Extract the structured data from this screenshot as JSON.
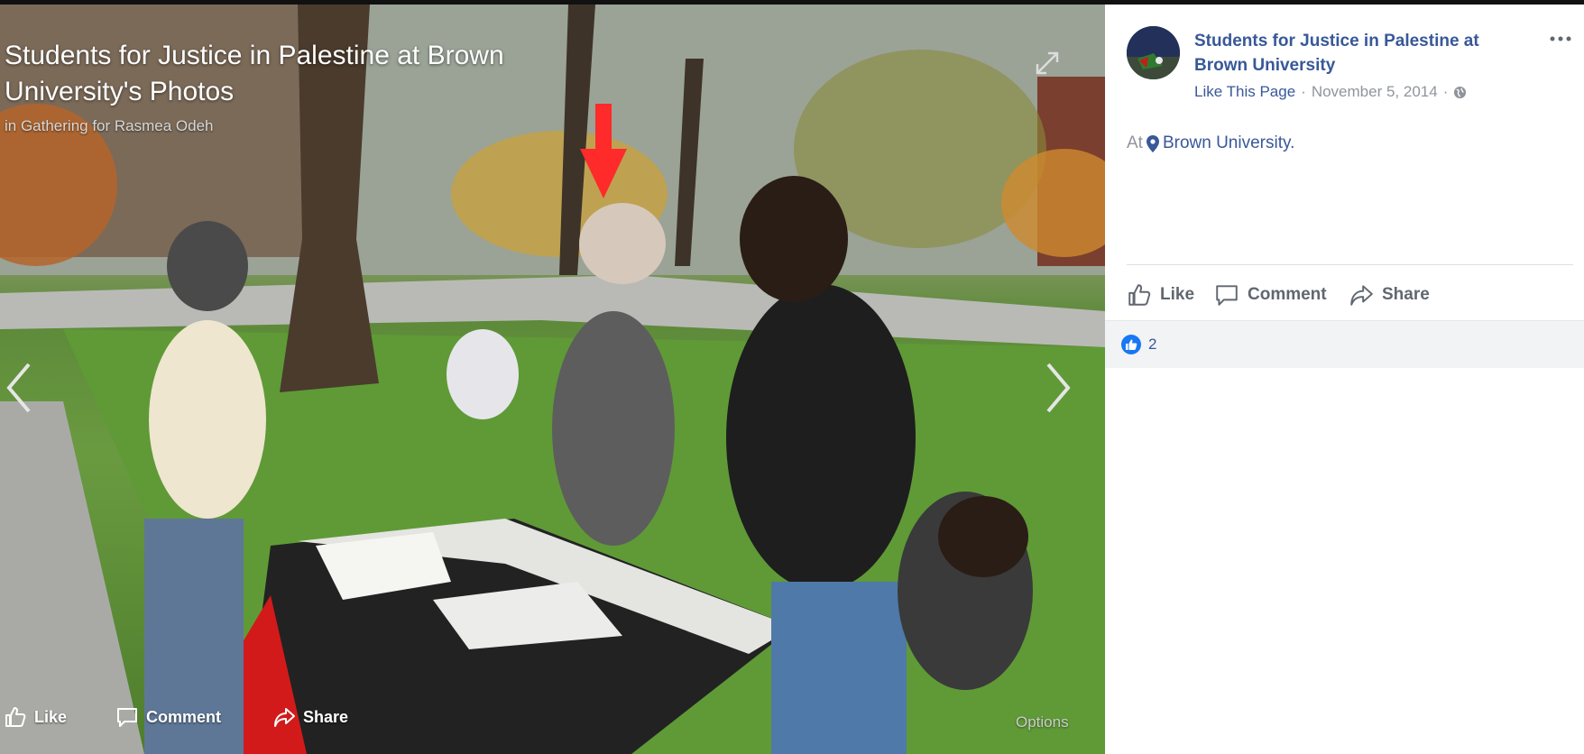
{
  "viewer": {
    "album_title": "Students for Justice in Palestine at Brown University's Photos",
    "album_subtitle": "in Gathering for Rasmea Odeh",
    "actions": {
      "like": "Like",
      "comment": "Comment",
      "share": "Share"
    },
    "options": "Options",
    "icons": [
      "expand-icon",
      "chevron-left-icon",
      "chevron-right-icon",
      "thumbs-up-icon",
      "comment-icon",
      "share-icon"
    ]
  },
  "panel": {
    "page_name": "Students for Justice in Palestine at Brown University",
    "like_page": "Like This Page",
    "separator": "·",
    "date": "November 5, 2014",
    "location_prefix": "At",
    "location": "Brown University.",
    "actions": {
      "like": "Like",
      "comment": "Comment",
      "share": "Share"
    },
    "reaction_count": "2"
  },
  "colors": {
    "link": "#385898",
    "meta": "#90949c",
    "action": "#606770",
    "like_blue": "#1877f2",
    "reactions_bg": "#f2f3f5"
  }
}
